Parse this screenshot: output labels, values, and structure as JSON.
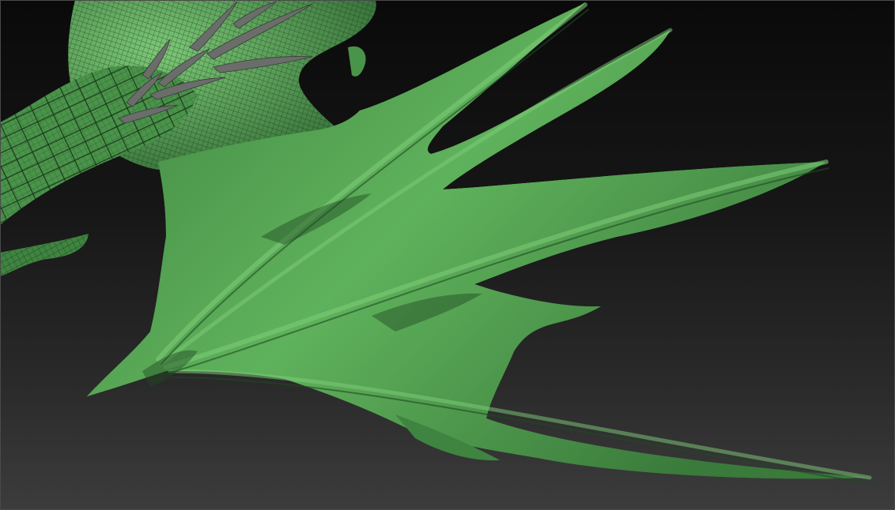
{
  "viewport": {
    "model": "wing-mesh",
    "colors": {
      "mesh_fill": "#4f9a4f",
      "mesh_highlight": "#7fce7a",
      "mesh_shadow": "#1f4a21",
      "wire": "#143016",
      "spike": "#6a6d6a",
      "background_top": "#0a0a0a",
      "background_bottom": "#3c3c3c"
    }
  }
}
